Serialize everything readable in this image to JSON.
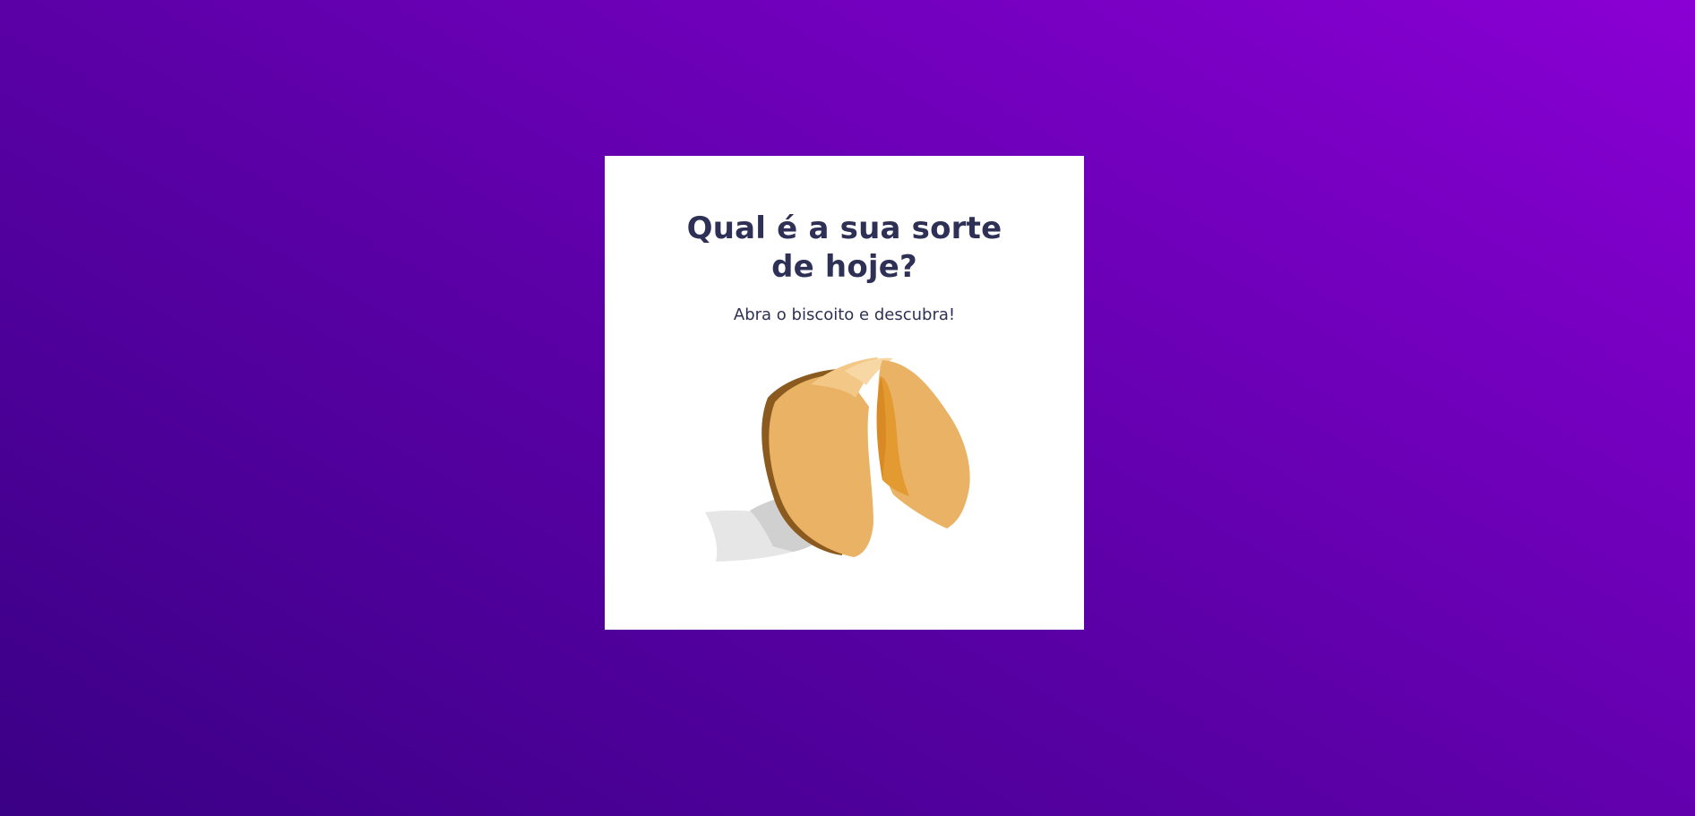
{
  "card": {
    "title": "Qual é a sua sorte de hoje?",
    "subtitle": "Abra o biscoito e descubra!",
    "cookie_icon": "fortune-cookie-icon"
  },
  "colors": {
    "background_start": "#3a0085",
    "background_end": "#8a00d4",
    "card": "#ffffff",
    "text": "#2e3155",
    "cookie": "#e9b264",
    "cookie_inner": "#e39a30",
    "cookie_shadow": "#8a5a1f",
    "paper": "#e6e6e6"
  }
}
